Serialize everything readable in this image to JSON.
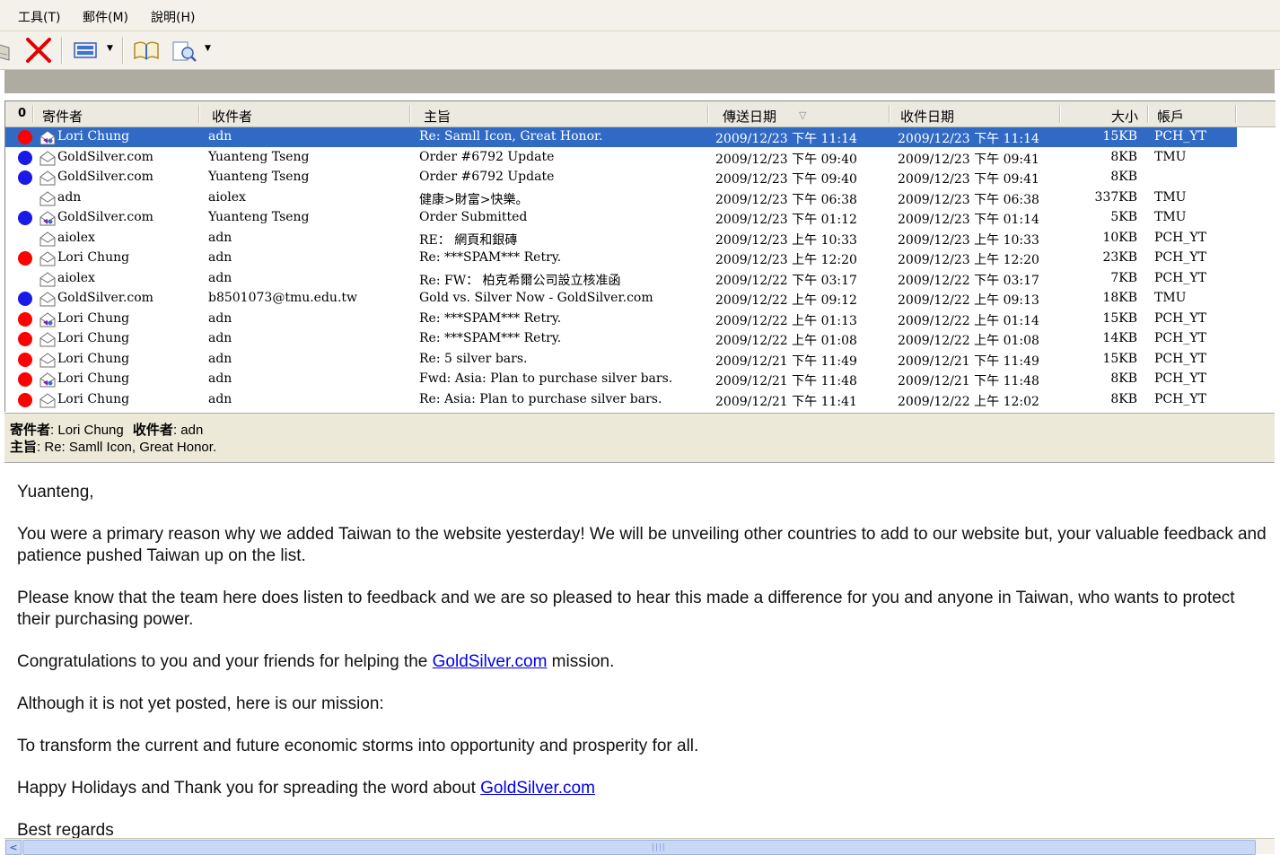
{
  "menu": {
    "items": [
      {
        "label": "工具(T)"
      },
      {
        "label": "郵件(M)"
      },
      {
        "label": "說明(H)"
      }
    ]
  },
  "columns": {
    "attach": "0",
    "from": "寄件者",
    "to": "收件者",
    "subject": "主旨",
    "sent": "傳送日期",
    "sort_indicator": "▽",
    "received": "收件日期",
    "size": "大小",
    "account": "帳戶"
  },
  "messages": [
    {
      "flag": "red",
      "env": "open-arrow",
      "from": "Lori Chung",
      "to": "adn",
      "subject": "Re: Samll Icon, Great Honor.",
      "sent": "2009/12/23 下午 11:14",
      "received": "2009/12/23 下午 11:14",
      "size": "15KB",
      "account": "PCH_YT",
      "selected": true
    },
    {
      "flag": "blue",
      "env": "open",
      "from": "GoldSilver.com",
      "to": "Yuanteng Tseng",
      "subject": "Order #6792 Update",
      "sent": "2009/12/23 下午 09:40",
      "received": "2009/12/23 下午 09:41",
      "size": "8KB",
      "account": "TMU"
    },
    {
      "flag": "blue",
      "env": "open",
      "from": "GoldSilver.com",
      "to": "Yuanteng Tseng",
      "subject": "Order #6792 Update",
      "sent": "2009/12/23 下午 09:40",
      "received": "2009/12/23 下午 09:41",
      "size": "8KB",
      "account": ""
    },
    {
      "flag": "none",
      "env": "open",
      "from": "adn",
      "to": "aiolex",
      "subject": "健康>財富>快樂。",
      "sent": "2009/12/23 下午 06:38",
      "received": "2009/12/23 下午 06:38",
      "size": "337KB",
      "account": "TMU"
    },
    {
      "flag": "blue",
      "env": "open-arrow",
      "from": "GoldSilver.com",
      "to": "Yuanteng Tseng",
      "subject": "Order Submitted",
      "sent": "2009/12/23 下午 01:12",
      "received": "2009/12/23 下午 01:14",
      "size": "5KB",
      "account": "TMU"
    },
    {
      "flag": "none",
      "env": "open",
      "from": "aiolex",
      "to": "adn",
      "subject": "RE： 網頁和銀磚",
      "sent": "2009/12/23 上午 10:33",
      "received": "2009/12/23 上午 10:33",
      "size": "10KB",
      "account": "PCH_YT"
    },
    {
      "flag": "red",
      "env": "open",
      "from": "Lori Chung",
      "to": "adn",
      "subject": "Re: ***SPAM*** Retry.",
      "sent": "2009/12/23 上午 12:20",
      "received": "2009/12/23 上午 12:20",
      "size": "23KB",
      "account": "PCH_YT"
    },
    {
      "flag": "none",
      "env": "open",
      "from": "aiolex",
      "to": "adn",
      "subject": "Re: FW： 柏克希爾公司設立核准函",
      "sent": "2009/12/22 下午 03:17",
      "received": "2009/12/22 下午 03:17",
      "size": "7KB",
      "account": "PCH_YT"
    },
    {
      "flag": "blue",
      "env": "open",
      "from": "GoldSilver.com",
      "to": "b8501073@tmu.edu.tw",
      "subject": "Gold vs. Silver Now - GoldSilver.com",
      "sent": "2009/12/22 上午 09:12",
      "received": "2009/12/22 上午 09:13",
      "size": "18KB",
      "account": "TMU"
    },
    {
      "flag": "red",
      "env": "open-arrow",
      "from": "Lori Chung",
      "to": "adn",
      "subject": "Re: ***SPAM*** Retry.",
      "sent": "2009/12/22 上午 01:13",
      "received": "2009/12/22 上午 01:14",
      "size": "15KB",
      "account": "PCH_YT"
    },
    {
      "flag": "red",
      "env": "open",
      "from": "Lori Chung",
      "to": "adn",
      "subject": "Re: ***SPAM*** Retry.",
      "sent": "2009/12/22 上午 01:08",
      "received": "2009/12/22 上午 01:08",
      "size": "14KB",
      "account": "PCH_YT"
    },
    {
      "flag": "red",
      "env": "open",
      "from": "Lori Chung",
      "to": "adn",
      "subject": "Re: 5 silver bars.",
      "sent": "2009/12/21 下午 11:49",
      "received": "2009/12/21 下午 11:49",
      "size": "15KB",
      "account": "PCH_YT"
    },
    {
      "flag": "red",
      "env": "open-arrow",
      "from": "Lori Chung",
      "to": "adn",
      "subject": "Fwd: Asia: Plan to purchase silver bars.",
      "sent": "2009/12/21 下午 11:48",
      "received": "2009/12/21 下午 11:48",
      "size": "8KB",
      "account": "PCH_YT"
    },
    {
      "flag": "red",
      "env": "open",
      "from": "Lori Chung",
      "to": "adn",
      "subject": "Re: Asia: Plan to purchase silver bars.",
      "sent": "2009/12/21 下午 11:41",
      "received": "2009/12/22 上午 12:02",
      "size": "8KB",
      "account": "PCH_YT"
    }
  ],
  "preview": {
    "from_label": "寄件者",
    "from": "Lori Chung",
    "to_label": "收件者",
    "to": "adn",
    "subject_label": "主旨",
    "subject": "Re: Samll Icon, Great Honor."
  },
  "body": {
    "greeting": "Yuanteng,",
    "p1": "You were a primary reason why we added Taiwan to the website yesterday! We will be unveiling other countries to add to our website but, your valuable feedback and patience pushed Taiwan up on the list.",
    "p2": "Please know that the team here does listen to feedback and we are so pleased to hear this made a difference for you and anyone in Taiwan, who wants to protect their purchasing power.",
    "p3_pre": "Congratulations to you and your friends for helping the ",
    "p3_link": "GoldSilver.com",
    "p3_post": " mission.",
    "p4": "Although it is not yet posted, here is our mission:",
    "p5": "To transform the current and future economic storms into opportunity and prosperity for all.",
    "p6_pre": "Happy Holidays and Thank you for spreading the word about ",
    "p6_link": "GoldSilver.com",
    "p7": "Best regards"
  },
  "colors": {
    "selection": "#316ac5",
    "flag_red": "#ff0000",
    "flag_blue": "#1a1ae6",
    "link": "#0000ee"
  }
}
